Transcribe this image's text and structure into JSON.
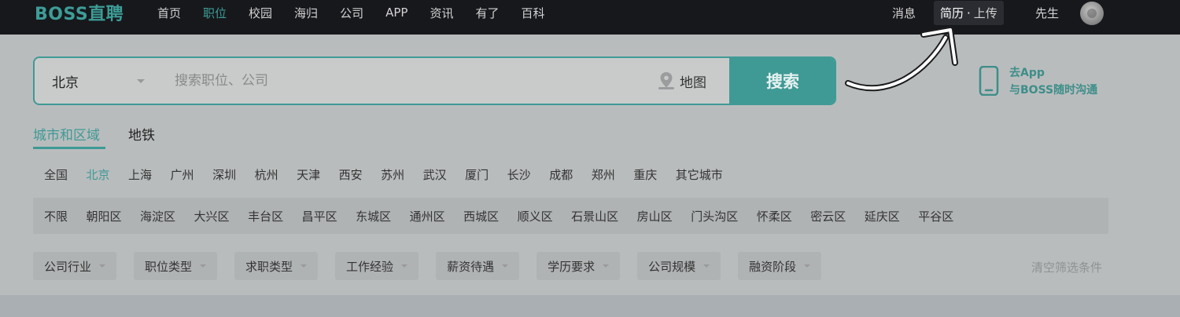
{
  "brand": {
    "logo": "BOSS直聘"
  },
  "nav": {
    "items": [
      "首页",
      "职位",
      "校园",
      "海归",
      "公司",
      "APP",
      "资讯",
      "有了",
      "百科"
    ],
    "active_index": 1
  },
  "user_nav": {
    "messages": "消息",
    "resume": "简历",
    "dot": "·",
    "upload": "上传",
    "user": "先生"
  },
  "search": {
    "city": "北京",
    "placeholder": "搜索职位、公司",
    "map_label": "地图",
    "button": "搜索"
  },
  "app_promo": {
    "line1": "去App",
    "line2": "与BOSS随时沟通"
  },
  "region_tabs": {
    "city_area": "城市和区域",
    "subway": "地铁"
  },
  "cities": {
    "items": [
      "全国",
      "北京",
      "上海",
      "广州",
      "深圳",
      "杭州",
      "天津",
      "西安",
      "苏州",
      "武汉",
      "厦门",
      "长沙",
      "成都",
      "郑州",
      "重庆",
      "其它城市"
    ],
    "active_index": 1
  },
  "districts": {
    "items": [
      "不限",
      "朝阳区",
      "海淀区",
      "大兴区",
      "丰台区",
      "昌平区",
      "东城区",
      "通州区",
      "西城区",
      "顺义区",
      "石景山区",
      "房山区",
      "门头沟区",
      "怀柔区",
      "密云区",
      "延庆区",
      "平谷区"
    ]
  },
  "filters": {
    "items": [
      "公司行业",
      "职位类型",
      "求职类型",
      "工作经验",
      "薪资待遇",
      "学历要求",
      "公司规模",
      "融资阶段"
    ],
    "clear": "清空筛选条件"
  },
  "colors": {
    "accent": "#3f9a95",
    "topbar": "#17181c",
    "overlay_bg": "#b9bcbd"
  }
}
